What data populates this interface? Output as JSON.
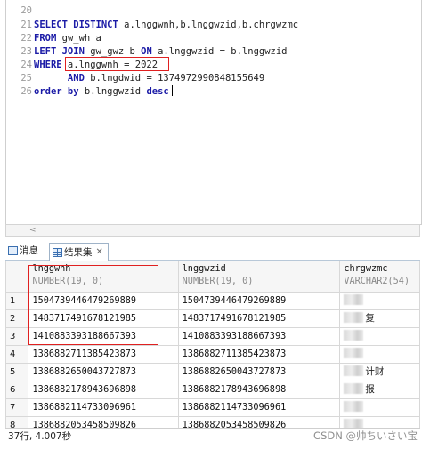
{
  "editor": {
    "lines": [
      {
        "num": "20",
        "parts": []
      },
      {
        "num": "21",
        "parts": [
          {
            "t": "SELECT DISTINCT",
            "k": true
          },
          {
            "t": " a.lnggwnh,b.lnggwzid,b.chrgwzmc",
            "k": false
          }
        ]
      },
      {
        "num": "22",
        "parts": [
          {
            "t": "FROM",
            "k": true
          },
          {
            "t": " gw_wh a",
            "k": false
          }
        ]
      },
      {
        "num": "23",
        "parts": [
          {
            "t": "LEFT JOIN",
            "k": true
          },
          {
            "t": " gw_gwz b ",
            "k": false
          },
          {
            "t": "ON",
            "k": true
          },
          {
            "t": " a.lnggwzid = b.lnggwzid",
            "k": false
          }
        ]
      },
      {
        "num": "24",
        "parts": [
          {
            "t": "WHERE",
            "k": true
          },
          {
            "t": " a.lnggwnh = 2022",
            "k": false
          }
        ]
      },
      {
        "num": "25",
        "parts": [
          {
            "t": "      AND",
            "k": true
          },
          {
            "t": " b.lngdwid = 1374972990848155649",
            "k": false
          }
        ]
      },
      {
        "num": "26",
        "parts": [
          {
            "t": "order by",
            "k": true
          },
          {
            "t": " b.lnggwzid ",
            "k": false
          },
          {
            "t": "desc",
            "k": true
          }
        ]
      }
    ]
  },
  "tabs": {
    "messages_label": "消息",
    "results_label": "结果集",
    "close_glyph": "✕"
  },
  "grid": {
    "columns": [
      {
        "name": "lnggwnh",
        "type": "NUMBER(19, 0)"
      },
      {
        "name": "lnggwzid",
        "type": "NUMBER(19, 0)"
      },
      {
        "name": "chrgwzmc",
        "type": "VARCHAR2(54)"
      }
    ],
    "rows": [
      {
        "n": "1",
        "c1": "1504739446479269889",
        "c2": "1504739446479269889",
        "c3": ""
      },
      {
        "n": "2",
        "c1": "1483717491678121985",
        "c2": "1483717491678121985",
        "c3": "复"
      },
      {
        "n": "3",
        "c1": "1410883393188667393",
        "c2": "1410883393188667393",
        "c3": ""
      },
      {
        "n": "4",
        "c1": "1386882711385423873",
        "c2": "1386882711385423873",
        "c3": ""
      },
      {
        "n": "5",
        "c1": "1386882650043727873",
        "c2": "1386882650043727873",
        "c3": "计财"
      },
      {
        "n": "6",
        "c1": "1386882178943696898",
        "c2": "1386882178943696898",
        "c3": "报"
      },
      {
        "n": "7",
        "c1": "1386882114733096961",
        "c2": "1386882114733096961",
        "c3": ""
      },
      {
        "n": "8",
        "c1": "1386882053458509826",
        "c2": "1386882053458509826",
        "c3": ""
      }
    ]
  },
  "status": {
    "text": "37行, 4.007秒"
  },
  "watermark": "CSDN @帅ちいさい宝",
  "colors": {
    "keyword": "#1a1aa6",
    "highlight_box": "#e02020"
  }
}
